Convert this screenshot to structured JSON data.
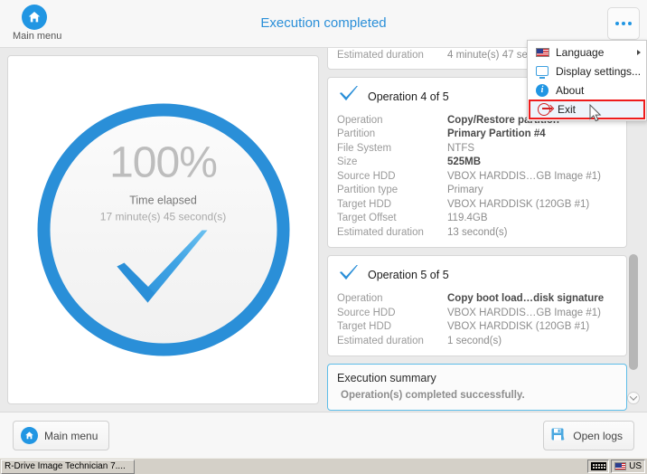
{
  "header": {
    "home_label": "Main menu",
    "title": "Execution completed",
    "more_icon": "ellipsis-icon"
  },
  "menu": {
    "items": [
      {
        "label": "Language",
        "icon": "flag-icon",
        "submenu": true,
        "highlighted": false
      },
      {
        "label": "Display settings...",
        "icon": "monitor-icon",
        "submenu": false,
        "highlighted": false
      },
      {
        "label": "About",
        "icon": "info-icon",
        "submenu": false,
        "highlighted": false
      },
      {
        "label": "Exit",
        "icon": "exit-icon",
        "submenu": false,
        "highlighted": true
      }
    ],
    "highlight_color": "#ee1c1c"
  },
  "progress": {
    "percent": "100%",
    "elapsed_label": "Time elapsed",
    "elapsed_value": "17 minute(s) 45 second(s)",
    "ring_color": "#2a8fd8",
    "check_icon": "check-icon"
  },
  "operations": {
    "partial_top": {
      "rows": [
        {
          "key": "Estimated duration",
          "value": "4 minute(s) 47 se",
          "bold": false
        }
      ]
    },
    "cards": [
      {
        "title": "Operation 4 of 5",
        "icon": "check-icon",
        "rows": [
          {
            "key": "Operation",
            "value": "Copy/Restore partition",
            "bold": true
          },
          {
            "key": "Partition",
            "value": "Primary Partition #4",
            "bold": true
          },
          {
            "key": "File System",
            "value": "NTFS",
            "bold": false
          },
          {
            "key": "Size",
            "value": "525MB",
            "bold": true
          },
          {
            "key": "Source HDD",
            "value": "VBOX HARDDIS…GB Image #1)",
            "bold": false
          },
          {
            "key": "Partition type",
            "value": "Primary",
            "bold": false
          },
          {
            "key": "Target HDD",
            "value": "VBOX HARDDISK (120GB #1)",
            "bold": false
          },
          {
            "key": "Target Offset",
            "value": "119.4GB",
            "bold": false
          },
          {
            "key": "Estimated duration",
            "value": "13 second(s)",
            "bold": false
          }
        ]
      },
      {
        "title": "Operation 5 of 5",
        "icon": "check-icon",
        "rows": [
          {
            "key": "Operation",
            "value": "Copy boot load…disk signature",
            "bold": true
          },
          {
            "key": "Source HDD",
            "value": "VBOX HARDDIS…GB Image #1)",
            "bold": false
          },
          {
            "key": "Target HDD",
            "value": "VBOX HARDDISK (120GB #1)",
            "bold": false
          },
          {
            "key": "Estimated duration",
            "value": "1 second(s)",
            "bold": false
          }
        ]
      }
    ],
    "summary": {
      "title": "Execution summary",
      "text": "Operation(s) completed successfully.",
      "border_color": "#5dbde8"
    }
  },
  "footer": {
    "main_menu_label": "Main menu",
    "open_logs_label": "Open logs"
  },
  "taskbar": {
    "task_label": "R-Drive Image Technician 7....",
    "lang_label": "US",
    "keyboard_icon": "keyboard-icon",
    "flag_icon": "flag-icon"
  }
}
